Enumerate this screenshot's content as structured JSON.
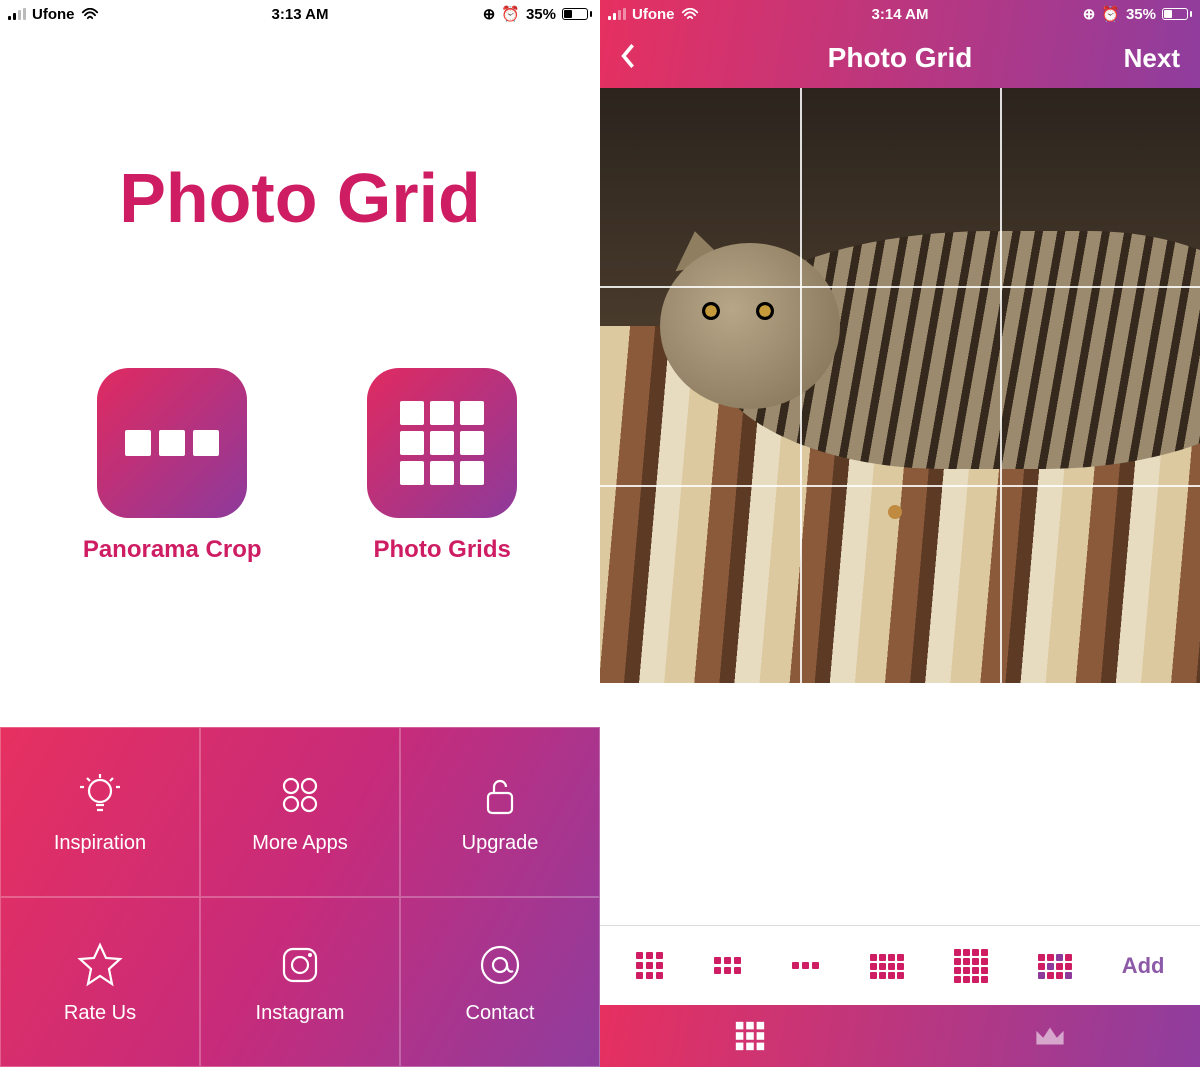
{
  "colors": {
    "brand_pink": "#cf1d63",
    "grad_start": "#e63060",
    "grad_end": "#8f3d9e"
  },
  "screen_left": {
    "status": {
      "carrier": "Ufone",
      "time": "3:13 AM",
      "battery_pct": "35%"
    },
    "title": "Photo Grid",
    "tiles": {
      "panorama": {
        "icon": "panorama-3-icon",
        "label": "Panorama Crop"
      },
      "grids": {
        "icon": "grid-9-icon",
        "label": "Photo Grids"
      }
    },
    "menu": [
      {
        "icon": "lightbulb-icon",
        "label": "Inspiration"
      },
      {
        "icon": "apps-icon",
        "label": "More Apps"
      },
      {
        "icon": "unlock-icon",
        "label": "Upgrade"
      },
      {
        "icon": "star-icon",
        "label": "Rate Us"
      },
      {
        "icon": "instagram-icon",
        "label": "Instagram"
      },
      {
        "icon": "at-icon",
        "label": "Contact"
      }
    ]
  },
  "screen_right": {
    "status": {
      "carrier": "Ufone",
      "time": "3:14 AM",
      "battery_pct": "35%"
    },
    "header": {
      "back_icon": "chevron-left-icon",
      "title": "Photo Grid",
      "next": "Next"
    },
    "preview": {
      "grid": "3x3",
      "subject": "tabby cat on striped cushion"
    },
    "layout_options": [
      {
        "name": "grid-3x3",
        "cols": 3,
        "rows": 3
      },
      {
        "name": "grid-3x2",
        "cols": 3,
        "rows": 2
      },
      {
        "name": "grid-3x1",
        "cols": 3,
        "rows": 1
      },
      {
        "name": "grid-4x3",
        "cols": 4,
        "rows": 3
      },
      {
        "name": "grid-4x4",
        "cols": 4,
        "rows": 4
      },
      {
        "name": "grid-4x3-b",
        "cols": 4,
        "rows": 3
      }
    ],
    "add_label": "Add",
    "tabs": {
      "grid_icon": "grid-icon",
      "premium_icon": "crown-icon"
    }
  }
}
